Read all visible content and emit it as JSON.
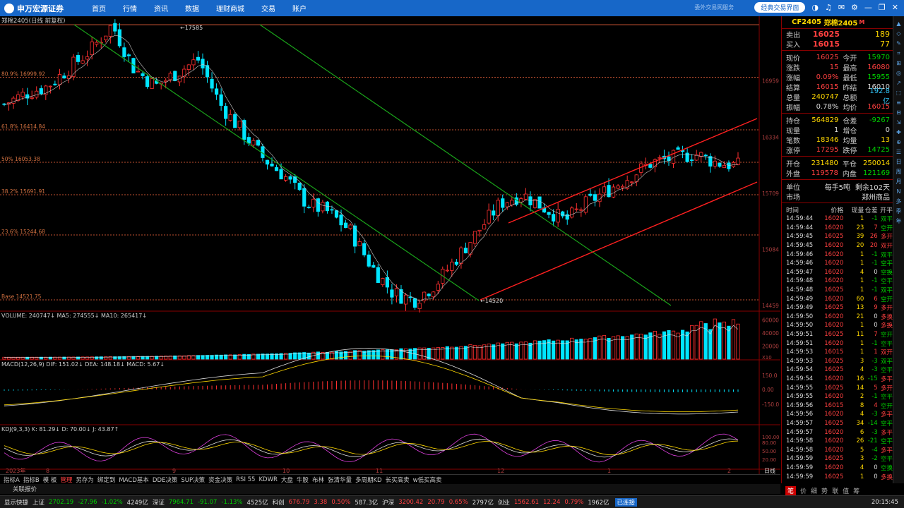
{
  "app": {
    "brand": "申万宏源证券",
    "menu": [
      "首页",
      "行情",
      "资讯",
      "数据",
      "理财商城",
      "交易",
      "账户"
    ],
    "top_ghost": "委外交易网服务",
    "classic_btn": "经典交易界面",
    "icons": [
      "skin-icon",
      "headset-icon",
      "mail-icon",
      "settings-icon",
      "minimize-icon",
      "restore-icon",
      "close-icon"
    ]
  },
  "chart": {
    "title": "郑棉2405(日线 前复权)",
    "fib": [
      {
        "label": "80.9% 16999.92",
        "price": 16999.92
      },
      {
        "label": "61.8% 16414.84",
        "price": 16414.84
      },
      {
        "label": "50% 16053.38",
        "price": 16053.38
      },
      {
        "label": "38.2% 15691.91",
        "price": 15691.91
      },
      {
        "label": "23.6% 15244.68",
        "price": 15244.68
      },
      {
        "label": "Base 14521.75",
        "price": 14521.75
      }
    ],
    "price_axis": [
      "16959",
      "16334",
      "15709",
      "15084",
      "14459"
    ],
    "high_mark": "17585",
    "low_mark": "14520",
    "volume_label": "VOLUME: 240747↓  MA5: 274555↓  MA10: 265417↓",
    "volume_axis": [
      "60000",
      "40000",
      "20000",
      "X10"
    ],
    "macd_label": "MACD(12,26,9)  DIF: 151.02↓  DEA: 148.18↓  MACD: 5.67↓",
    "macd_axis": [
      "150.0",
      "0.00",
      "-150.0"
    ],
    "kdj_label": "KDJ(9,3,3)  K: 81.29↓  D: 70.00↓  J: 43.87↑",
    "kdj_axis": [
      "100.00",
      "80.00",
      "50.00",
      "20.00"
    ],
    "date_axis": [
      "2023年",
      "8",
      "9",
      "10",
      "11",
      "12",
      "1",
      "2"
    ],
    "period": "日线",
    "colors": {
      "up": "#ff3030",
      "down": "#00e5ff",
      "ma": "#ffd800",
      "green_line": "#1aa11a",
      "red_line": "#ff2020"
    }
  },
  "chart_data": {
    "type": "candlestick",
    "series": [
      {
        "name": "郑棉2405",
        "close_path": [
          16700,
          16820,
          16900,
          17100,
          17300,
          17585,
          17100,
          16900,
          17050,
          17200,
          16700,
          16400,
          16100,
          15900,
          15600,
          15500,
          15300,
          14900,
          14600,
          14520,
          14700,
          15000,
          15300,
          15600,
          15700,
          15550,
          15400,
          15600,
          15750,
          15900,
          16050,
          16100,
          16150,
          16050,
          16015
        ]
      }
    ]
  },
  "quote": {
    "code": "CF2405",
    "name": "郑棉2405",
    "mkt": "M",
    "sell": {
      "label": "卖出",
      "price": "16025",
      "vol": "189"
    },
    "buy": {
      "label": "买入",
      "price": "16015",
      "vol": "77"
    },
    "rows": [
      [
        {
          "l": "现价",
          "v": "16025",
          "c": "red"
        },
        {
          "l": "今开",
          "v": "15970",
          "c": "grn"
        }
      ],
      [
        {
          "l": "涨跌",
          "v": "15",
          "c": "red"
        },
        {
          "l": "最高",
          "v": "16080",
          "c": "red"
        }
      ],
      [
        {
          "l": "涨幅",
          "v": "0.09%",
          "c": "red"
        },
        {
          "l": "最低",
          "v": "15955",
          "c": "grn"
        }
      ],
      [
        {
          "l": "结算",
          "v": "16015",
          "c": "red"
        },
        {
          "l": "昨结",
          "v": "16010",
          "c": "wht"
        }
      ],
      [
        {
          "l": "总量",
          "v": "240747",
          "c": "yel"
        },
        {
          "l": "总额",
          "v": "192.8亿",
          "c": "cyan"
        }
      ],
      [
        {
          "l": "振幅",
          "v": "0.78%",
          "c": "wht"
        },
        {
          "l": "均价",
          "v": "16015",
          "c": "red"
        }
      ]
    ],
    "rows2": [
      [
        {
          "l": "持仓",
          "v": "564829",
          "c": "yel"
        },
        {
          "l": "仓差",
          "v": "-9267",
          "c": "grn"
        }
      ],
      [
        {
          "l": "现量",
          "v": "1",
          "c": "wht"
        },
        {
          "l": "增仓",
          "v": "0",
          "c": "wht"
        }
      ],
      [
        {
          "l": "笔数",
          "v": "18346",
          "c": "yel"
        },
        {
          "l": "均量",
          "v": "13",
          "c": "yel"
        }
      ],
      [
        {
          "l": "涨停",
          "v": "17295",
          "c": "red"
        },
        {
          "l": "跌停",
          "v": "14725",
          "c": "grn"
        }
      ]
    ],
    "rows3": [
      [
        {
          "l": "开仓",
          "v": "231480",
          "c": "yel"
        },
        {
          "l": "平仓",
          "v": "250014",
          "c": "yel"
        }
      ],
      [
        {
          "l": "外盘",
          "v": "119578",
          "c": "red"
        },
        {
          "l": "内盘",
          "v": "121169",
          "c": "grn"
        }
      ]
    ],
    "unit": {
      "l": "单位",
      "v": "每手5吨",
      "v2": "剩余102天"
    },
    "market": {
      "l": "市场",
      "v": "郑州商品"
    },
    "tick_head": [
      "时间",
      "价格",
      "现量",
      "仓差",
      "开平"
    ],
    "ticks": [
      [
        "14:59:44",
        "16020",
        "1",
        "-1",
        "双平"
      ],
      [
        "14:59:44",
        "16020",
        "23",
        "7",
        "空开"
      ],
      [
        "14:59:45",
        "16025",
        "39",
        "26",
        "多开"
      ],
      [
        "14:59:45",
        "16020",
        "20",
        "20",
        "双开"
      ],
      [
        "14:59:46",
        "16020",
        "1",
        "-1",
        "双平"
      ],
      [
        "14:59:46",
        "16020",
        "1",
        "-1",
        "空平"
      ],
      [
        "14:59:47",
        "16020",
        "4",
        "0",
        "空换"
      ],
      [
        "14:59:48",
        "16020",
        "1",
        "-1",
        "空平"
      ],
      [
        "14:59:48",
        "16025",
        "1",
        "-1",
        "双平"
      ],
      [
        "14:59:49",
        "16020",
        "60",
        "6",
        "空开"
      ],
      [
        "14:59:49",
        "16025",
        "13",
        "9",
        "多开"
      ],
      [
        "14:59:50",
        "16020",
        "21",
        "0",
        "多换"
      ],
      [
        "14:59:50",
        "16020",
        "1",
        "0",
        "多换"
      ],
      [
        "14:59:51",
        "16025",
        "11",
        "7",
        "空开"
      ],
      [
        "14:59:51",
        "16020",
        "1",
        "-1",
        "空平"
      ],
      [
        "14:59:53",
        "16015",
        "1",
        "1",
        "双开"
      ],
      [
        "14:59:53",
        "16025",
        "3",
        "-3",
        "双平"
      ],
      [
        "14:59:54",
        "16025",
        "4",
        "-3",
        "空平"
      ],
      [
        "14:59:54",
        "16020",
        "16",
        "-15",
        "多平"
      ],
      [
        "14:59:55",
        "16025",
        "14",
        "5",
        "多开"
      ],
      [
        "14:59:55",
        "16020",
        "2",
        "-1",
        "空平"
      ],
      [
        "14:59:56",
        "16015",
        "8",
        "4",
        "空开"
      ],
      [
        "14:59:56",
        "16020",
        "4",
        "-3",
        "多平"
      ],
      [
        "14:59:57",
        "16025",
        "34",
        "-14",
        "空平"
      ],
      [
        "14:59:57",
        "16020",
        "6",
        "-3",
        "多平"
      ],
      [
        "14:59:58",
        "16020",
        "26",
        "-21",
        "空平"
      ],
      [
        "14:59:58",
        "16020",
        "5",
        "-4",
        "多平"
      ],
      [
        "14:59:59",
        "16025",
        "3",
        "-2",
        "空平"
      ],
      [
        "14:59:59",
        "16020",
        "4",
        "0",
        "空换"
      ],
      [
        "14:59:59",
        "16025",
        "1",
        "0",
        "多换"
      ]
    ],
    "tabs": [
      "笔",
      "价",
      "细",
      "势",
      "联",
      "值",
      "筹"
    ]
  },
  "bottom_tabs": [
    "指标A",
    "指标B",
    "模 板",
    "管理",
    "另存为",
    "绑定到",
    "MACD基本",
    "DDE决策",
    "SUP决策",
    "资金决策",
    "RSI 55",
    "KDWR",
    "大盘",
    "牛股",
    "布林",
    "张清华量",
    "多周期KD",
    "长买高卖",
    "w低买高卖"
  ],
  "bottom_tabs_active": 3,
  "link_tab": "关联报价",
  "status": {
    "items": [
      {
        "t": "显示快捷",
        "c": "#ddd"
      },
      {
        "t": "上证",
        "c": "#ddd"
      },
      {
        "t": "2702.19",
        "c": "#00d000"
      },
      {
        "t": "-27.96",
        "c": "#00d000"
      },
      {
        "t": "-1.02%",
        "c": "#00d000"
      },
      {
        "t": "4249亿",
        "c": "#ddd"
      },
      {
        "t": "深证",
        "c": "#ddd"
      },
      {
        "t": "7964.71",
        "c": "#00d000"
      },
      {
        "t": "-91.07",
        "c": "#00d000"
      },
      {
        "t": "-1.13%",
        "c": "#00d000"
      },
      {
        "t": "4525亿",
        "c": "#ddd"
      },
      {
        "t": "科创",
        "c": "#ddd"
      },
      {
        "t": "676.79",
        "c": "#ff4040"
      },
      {
        "t": "3.38",
        "c": "#ff4040"
      },
      {
        "t": "0.50%",
        "c": "#ff4040"
      },
      {
        "t": "587.3亿",
        "c": "#ddd"
      },
      {
        "t": "沪深",
        "c": "#ddd"
      },
      {
        "t": "3200.42",
        "c": "#ff4040"
      },
      {
        "t": "20.79",
        "c": "#ff4040"
      },
      {
        "t": "0.65%",
        "c": "#ff4040"
      },
      {
        "t": "2797亿",
        "c": "#ddd"
      },
      {
        "t": "创业",
        "c": "#ddd"
      },
      {
        "t": "1562.61",
        "c": "#ff4040"
      },
      {
        "t": "12.24",
        "c": "#ff4040"
      },
      {
        "t": "0.79%",
        "c": "#ff4040"
      },
      {
        "t": "1962亿",
        "c": "#ddd"
      }
    ],
    "conn": "已连接",
    "time": "20:15:45"
  },
  "right_tools": [
    "▲",
    "◇",
    "✎",
    "⌗",
    "⊞",
    "◎",
    "↗",
    "⬚",
    "≡",
    "⊟",
    "⇲",
    "✚",
    "⊕",
    "☰",
    "日",
    "周",
    "月",
    "N",
    "多",
    "季",
    "年"
  ]
}
